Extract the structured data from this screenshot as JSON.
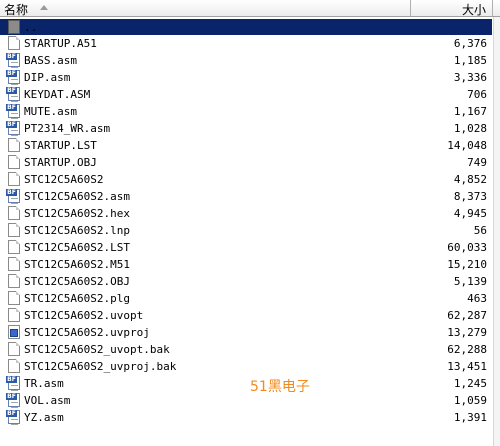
{
  "header": {
    "name_label": "名称",
    "size_label": "大小"
  },
  "rows": [
    {
      "name": "..",
      "size": "",
      "icon": "folder-up-icon",
      "selected": true
    },
    {
      "name": "STARTUP.A51",
      "size": "6,376",
      "icon": "document-icon"
    },
    {
      "name": "BASS.asm",
      "size": "1,185",
      "icon": "bf-asm-icon"
    },
    {
      "name": "DIP.asm",
      "size": "3,336",
      "icon": "bf-asm-icon"
    },
    {
      "name": "KEYDAT.ASM",
      "size": "706",
      "icon": "bf-asm-icon"
    },
    {
      "name": "MUTE.asm",
      "size": "1,167",
      "icon": "bf-asm-icon"
    },
    {
      "name": "PT2314_WR.asm",
      "size": "1,028",
      "icon": "bf-asm-icon"
    },
    {
      "name": "STARTUP.LST",
      "size": "14,048",
      "icon": "document-icon"
    },
    {
      "name": "STARTUP.OBJ",
      "size": "749",
      "icon": "document-icon"
    },
    {
      "name": "STC12C5A60S2",
      "size": "4,852",
      "icon": "document-icon"
    },
    {
      "name": "STC12C5A60S2.asm",
      "size": "8,373",
      "icon": "bf-asm-icon"
    },
    {
      "name": "STC12C5A60S2.hex",
      "size": "4,945",
      "icon": "document-icon"
    },
    {
      "name": "STC12C5A60S2.lnp",
      "size": "56",
      "icon": "document-icon"
    },
    {
      "name": "STC12C5A60S2.LST",
      "size": "60,033",
      "icon": "document-icon"
    },
    {
      "name": "STC12C5A60S2.M51",
      "size": "15,210",
      "icon": "document-icon"
    },
    {
      "name": "STC12C5A60S2.OBJ",
      "size": "5,139",
      "icon": "document-icon"
    },
    {
      "name": "STC12C5A60S2.plg",
      "size": "463",
      "icon": "document-icon"
    },
    {
      "name": "STC12C5A60S2.uvopt",
      "size": "62,287",
      "icon": "document-icon"
    },
    {
      "name": "STC12C5A60S2.uvproj",
      "size": "13,279",
      "icon": "uvproj-icon"
    },
    {
      "name": "STC12C5A60S2_uvopt.bak",
      "size": "62,288",
      "icon": "document-icon"
    },
    {
      "name": "STC12C5A60S2_uvproj.bak",
      "size": "13,451",
      "icon": "document-icon"
    },
    {
      "name": "TR.asm",
      "size": "1,245",
      "icon": "bf-asm-icon"
    },
    {
      "name": "VOL.asm",
      "size": "1,059",
      "icon": "bf-asm-icon"
    },
    {
      "name": "YZ.asm",
      "size": "1,391",
      "icon": "bf-asm-icon"
    }
  ],
  "icon_badge_text": "BF",
  "watermark": "51黑电子",
  "colors": {
    "selection": "#0a246a",
    "watermark": "#f08a1c",
    "bf_badge": "#2b5aa8"
  }
}
